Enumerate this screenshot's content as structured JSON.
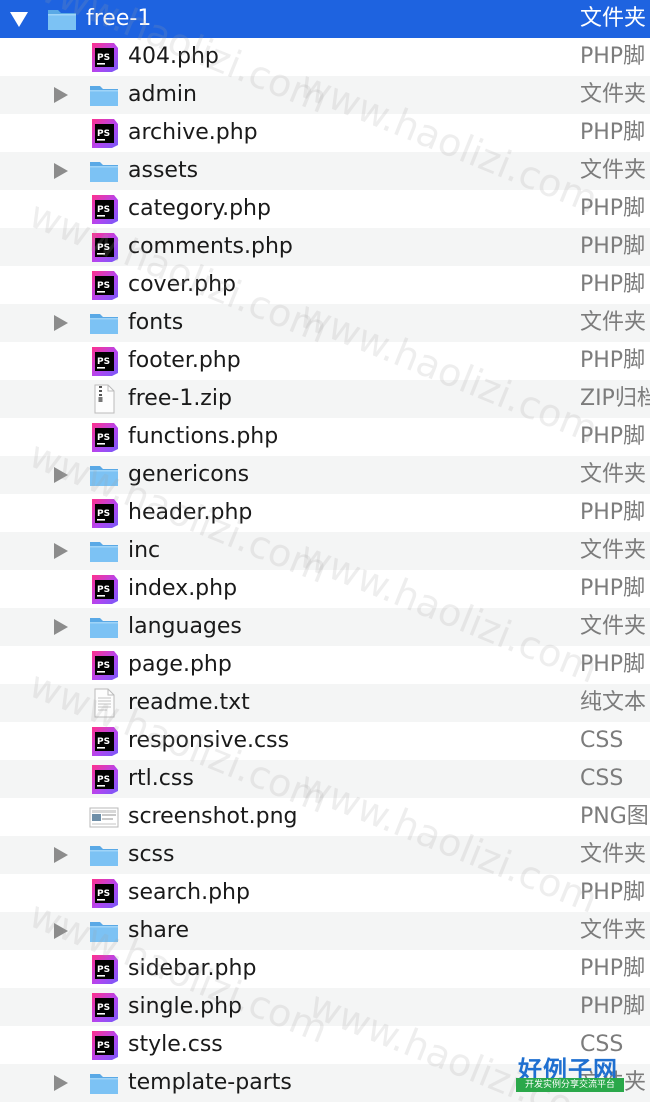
{
  "colors": {
    "selected_row": "#1e63e0",
    "alt_row": "#f4f5f5",
    "folder": "#6fb7ee",
    "phpstorm_pink": "#e0277f",
    "phpstorm_purple": "#7a3fd0"
  },
  "rows": [
    {
      "name": "free-1",
      "kind": "文件夹",
      "icon": "folder-icon",
      "expander": "expanded"
    },
    {
      "name": "404.php",
      "kind": "PHP脚",
      "icon": "phpstorm-file-icon"
    },
    {
      "name": "admin",
      "kind": "文件夹",
      "icon": "folder-icon",
      "expander": "collapsed"
    },
    {
      "name": "archive.php",
      "kind": "PHP脚",
      "icon": "phpstorm-file-icon"
    },
    {
      "name": "assets",
      "kind": "文件夹",
      "icon": "folder-icon",
      "expander": "collapsed"
    },
    {
      "name": "category.php",
      "kind": "PHP脚",
      "icon": "phpstorm-file-icon"
    },
    {
      "name": "comments.php",
      "kind": "PHP脚",
      "icon": "phpstorm-file-icon"
    },
    {
      "name": "cover.php",
      "kind": "PHP脚",
      "icon": "phpstorm-file-icon"
    },
    {
      "name": "fonts",
      "kind": "文件夹",
      "icon": "folder-icon",
      "expander": "collapsed"
    },
    {
      "name": "footer.php",
      "kind": "PHP脚",
      "icon": "phpstorm-file-icon"
    },
    {
      "name": "free-1.zip",
      "kind": "ZIP归档",
      "icon": "zip-file-icon"
    },
    {
      "name": "functions.php",
      "kind": "PHP脚",
      "icon": "phpstorm-file-icon"
    },
    {
      "name": "genericons",
      "kind": "文件夹",
      "icon": "folder-icon",
      "expander": "collapsed"
    },
    {
      "name": "header.php",
      "kind": "PHP脚",
      "icon": "phpstorm-file-icon"
    },
    {
      "name": "inc",
      "kind": "文件夹",
      "icon": "folder-icon",
      "expander": "collapsed"
    },
    {
      "name": "index.php",
      "kind": "PHP脚",
      "icon": "phpstorm-file-icon"
    },
    {
      "name": "languages",
      "kind": "文件夹",
      "icon": "folder-icon",
      "expander": "collapsed"
    },
    {
      "name": "page.php",
      "kind": "PHP脚",
      "icon": "phpstorm-file-icon"
    },
    {
      "name": "readme.txt",
      "kind": "纯文本",
      "icon": "text-file-icon"
    },
    {
      "name": "responsive.css",
      "kind": "CSS",
      "icon": "phpstorm-file-icon"
    },
    {
      "name": "rtl.css",
      "kind": "CSS",
      "icon": "phpstorm-file-icon"
    },
    {
      "name": "screenshot.png",
      "kind": "PNG图",
      "icon": "image-file-icon"
    },
    {
      "name": "scss",
      "kind": "文件夹",
      "icon": "folder-icon",
      "expander": "collapsed"
    },
    {
      "name": "search.php",
      "kind": "PHP脚",
      "icon": "phpstorm-file-icon"
    },
    {
      "name": "share",
      "kind": "文件夹",
      "icon": "folder-icon",
      "expander": "collapsed"
    },
    {
      "name": "sidebar.php",
      "kind": "PHP脚",
      "icon": "phpstorm-file-icon"
    },
    {
      "name": "single.php",
      "kind": "PHP脚",
      "icon": "phpstorm-file-icon"
    },
    {
      "name": "style.css",
      "kind": "CSS",
      "icon": "phpstorm-file-icon"
    },
    {
      "name": "template-parts",
      "kind": "文件夹",
      "icon": "folder-icon",
      "expander": "collapsed"
    }
  ],
  "watermark": {
    "text": "www.haolizi.com"
  },
  "badge": {
    "title": "好例子网",
    "subtitle": "开发实例分享交流平台"
  }
}
